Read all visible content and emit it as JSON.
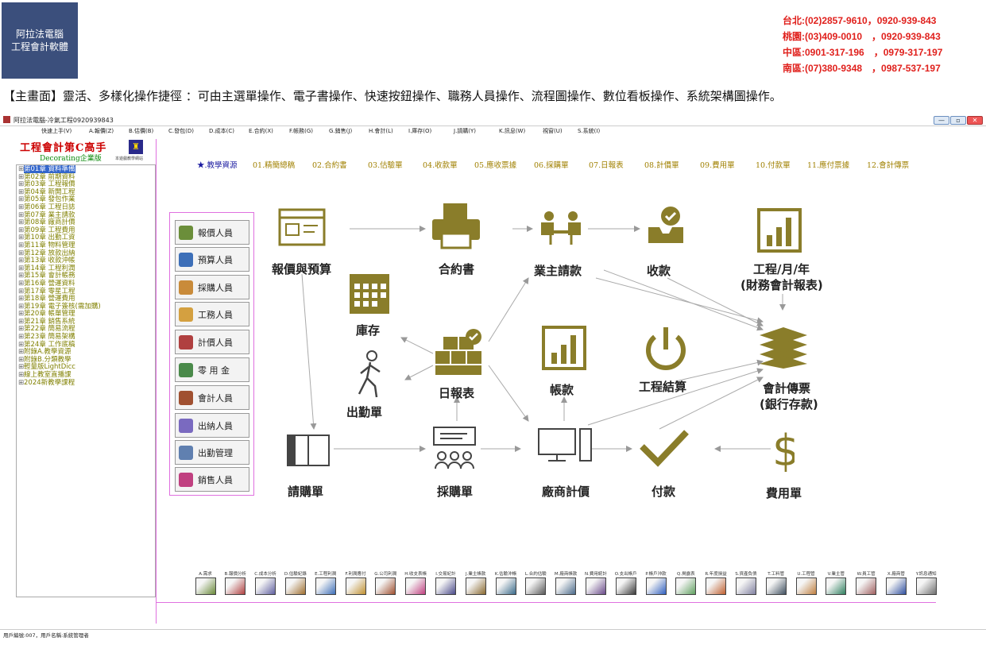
{
  "logo": {
    "line1": "阿拉法電腦",
    "line2": "工程會計軟體"
  },
  "contacts": [
    "台北:(02)2857-9610，0920-939-843",
    "桃園:(03)409-0010　，0920-939-843",
    "中區:0901-317-196　，0979-317-197",
    "南區:(07)380-9348　，0987-537-197"
  ],
  "caption": "【主畫面】靈活、多樣化操作捷徑 ：可由主選單操作、電子書操作、快速按鈕操作、職務人員操作、流程圖操作、數位看板操作、系統架構圖操作。",
  "window": {
    "title": "阿拉法電腦-冷氣工程0920939843",
    "min": "—",
    "max": "▫",
    "close": "✕"
  },
  "menu": [
    "快速上手(V)",
    "A.報價(Z)",
    "B.估價(B)",
    "C.發包(D)",
    "D.成本(C)",
    "E.合約(X)",
    "F.帳務(G)",
    "G.銷售(J)",
    "H.會計(L)",
    "I.庫存(O)",
    "J.請購(Y)",
    "K.訊息(W)",
    "視窗(U)",
    "S.系統(I)"
  ],
  "app": {
    "title": "工程會計第C高手",
    "edition_en": "Decorating",
    "edition_zh": "企業版",
    "icon_glyph": "♜",
    "icon_link": "本遊戲教學網站"
  },
  "chapters": [
    "第01章 資料準備",
    "第02章 前期資料",
    "第03章 工程報價",
    "第04章 新開工程",
    "第05章 發包作業",
    "第06章 工程日誌",
    "第07章 業主請款",
    "第08章 廠商計價",
    "第09章 工程費用",
    "第10章 出勤工資",
    "第11章 物料管理",
    "第12章 放款出納",
    "第13章 收款沖帳",
    "第14章 工程利潤",
    "第15章 會計帳務",
    "第16章 營運資料",
    "第17章 零星工程",
    "第18章 營運費用",
    "第19章 電子簽核(需加購)",
    "第20章 帳單管理",
    "第21章 銷售系統",
    "第22章 簡易流程",
    "第23章 簡易架構",
    "第24章 工作底稿",
    "附錄A.教學資源",
    "附錄B.分類教學",
    "輕量版LightDicc",
    "線上教室直播課",
    "2024新教學課程"
  ],
  "tabs": [
    "★.教學資源",
    "01.精簡總稿",
    "02.合約書",
    "03.估驗單",
    "04.收款單",
    "05.應收票據",
    "06.採購單",
    "07.日報表",
    "08.計價單",
    "09.費用單",
    "10.付款單",
    "11.應付票據",
    "12.會計傳票"
  ],
  "roles": [
    "報價人員",
    "預算人員",
    "採購人員",
    "工務人員",
    "計價人員",
    "零 用 金",
    "會計人員",
    "出納人員",
    "出勤管理",
    "銷售人員"
  ],
  "flow": {
    "quote": "報價與預算",
    "contract": "合約書",
    "owner_request": "業主請款",
    "receive": "收款",
    "report_l1": "工程/月/年",
    "report_l2": "(財務會計報表)",
    "inventory": "庫存",
    "daily": "日報表",
    "account": "帳款",
    "settle": "工程結算",
    "voucher_l1": "會計傳票",
    "voucher_l2": "(銀行存款)",
    "attendance": "出勤單",
    "purchase_req": "請購單",
    "purchase": "採購單",
    "vendor": "廠商計價",
    "payment": "付款",
    "expense": "費用單"
  },
  "toolbar": [
    "A.需求",
    "B.報價分析",
    "C.成本分析",
    "D.估驗紀錄",
    "E.工程利潤",
    "F.利潤應付",
    "G.公司利潤",
    "H.收支表帳",
    "I.交易紀計",
    "J.業主帳款",
    "K.估驗沖帳",
    "L.合約估驗",
    "M.廠商帳款",
    "N.費用統計",
    "O.支出帳戶",
    "P.帳戶沖款",
    "Q.揭露表",
    "R.年度損益",
    "S.資產負債",
    "T.工料管",
    "U.工程管",
    "V.業主管",
    "W.員工管",
    "X.廠商管",
    "Y.訊息通知"
  ],
  "status": "用戶編號:007，用戶名稱:系統管理者",
  "colors": {
    "accent": "#8a7d2a",
    "red": "#e0201c"
  }
}
